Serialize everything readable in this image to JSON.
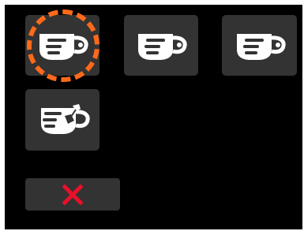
{
  "colors": {
    "screen_background": "#000000",
    "tile_background": "#333333",
    "icon": "#ffffff",
    "selection_accent": "#ff6a1a",
    "cancel_icon": "#e8102a"
  },
  "tiles": [
    {
      "icon": "cup-icon",
      "selected": true
    },
    {
      "icon": "cup-icon",
      "selected": false
    },
    {
      "icon": "cup-icon",
      "selected": false
    },
    {
      "icon": "tea-cup-icon",
      "selected": false
    }
  ],
  "cancel_button": {
    "icon": "close-icon"
  }
}
